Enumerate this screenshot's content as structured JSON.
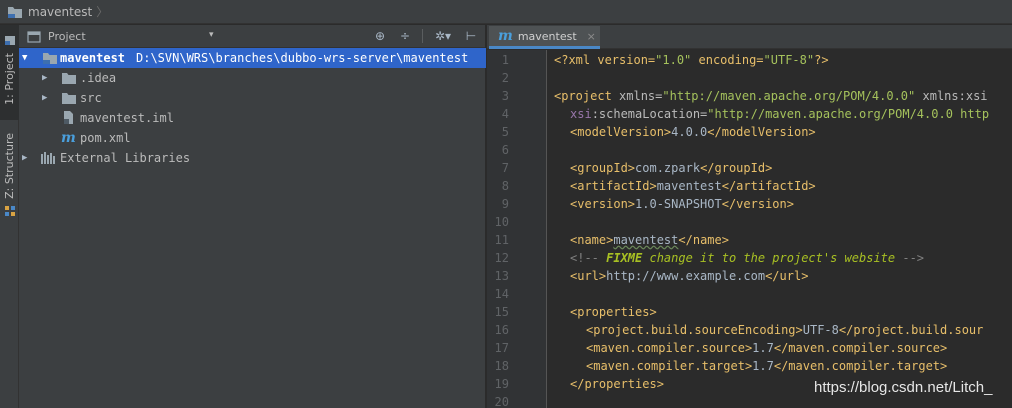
{
  "navbar": {
    "crumb": "maventest",
    "sep": "〉"
  },
  "stripe": {
    "project_label": "1: Project",
    "structure_label": "Z: Structure"
  },
  "project_panel": {
    "title": "Project",
    "dropdown": "▾",
    "tools": {
      "locate": "⊕",
      "collapse": "÷",
      "settings": "✲▾",
      "hide": "⊢"
    },
    "tree": {
      "root_name": "maventest",
      "root_path": "D:\\SVN\\WRS\\branches\\dubbo-wrs-server\\maventest",
      "idea": ".idea",
      "src": "src",
      "iml": "maventest.iml",
      "pom": "pom.xml",
      "ext": "External Libraries"
    }
  },
  "editor": {
    "tab_icon": "m",
    "tab_label": "maventest",
    "tab_close": "×",
    "line_numbers": [
      "1",
      "2",
      "3",
      "4",
      "5",
      "6",
      "7",
      "8",
      "9",
      "10",
      "11",
      "12",
      "13",
      "14",
      "15",
      "16",
      "17",
      "18",
      "19",
      "20"
    ],
    "code": {
      "l1_decl": "<?xml version=",
      "l1_v1": "\"1.0\"",
      "l1_enc": " encoding=",
      "l1_v2": "\"UTF-8\"",
      "l1_end": "?>",
      "l3_open": "<project ",
      "l3_attr": "xmlns=",
      "l3_val": "\"http://maven.apache.org/POM/4.0.0\"",
      "l3_more": " xmlns:xsi",
      "l4_ns": "xsi",
      "l4_attr": ":schemaLocation=",
      "l4_val": "\"http://maven.apache.org/POM/4.0.0 http",
      "l5_o": "<modelVersion>",
      "l5_t": "4.0.0",
      "l5_c": "</modelVersion>",
      "l7_o": "<groupId>",
      "l7_t": "com.zpark",
      "l7_c": "</groupId>",
      "l8_o": "<artifactId>",
      "l8_t": "maventest",
      "l8_c": "</artifactId>",
      "l9_o": "<version>",
      "l9_t": "1.0-SNAPSHOT",
      "l9_c": "</version>",
      "l11_o": "<name>",
      "l11_t": "maventest",
      "l11_c": "</name>",
      "l12_o": "<!-- ",
      "l12_k": "FIXME",
      "l12_t": " change it to the project's website",
      "l12_c": " -->",
      "l13_o": "<url>",
      "l13_t": "http://www.example.com",
      "l13_c": "</url>",
      "l15_o": "<properties>",
      "l16_o": "<project.build.sourceEncoding>",
      "l16_t": "UTF-8",
      "l16_c": "</project.build.sour",
      "l17_o": "<maven.compiler.source>",
      "l17_t": "1.7",
      "l17_c": "</maven.compiler.source>",
      "l18_o": "<maven.compiler.target>",
      "l18_t": "1.7",
      "l18_c": "</maven.compiler.target>",
      "l19_c": "</properties>"
    }
  },
  "watermark": "https://blog.csdn.net/Litch_",
  "colors": {
    "selection": "#2f65ca",
    "tag": "#e8bf6a",
    "string": "#a5c25c",
    "todo": "#a8c023"
  }
}
